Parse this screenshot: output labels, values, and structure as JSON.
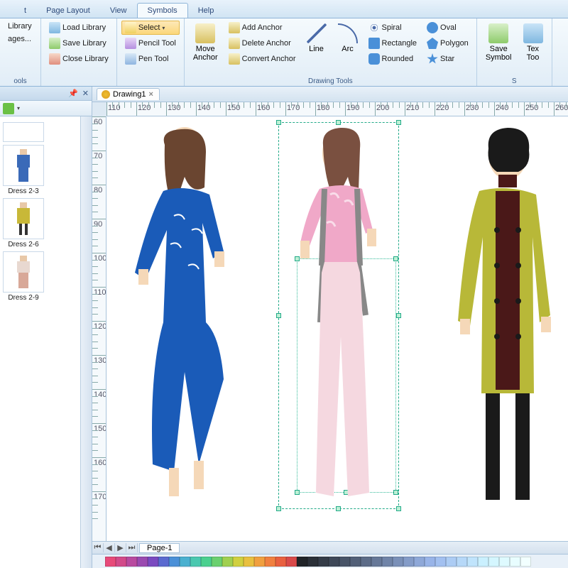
{
  "tabs": {
    "t0": "t",
    "t1": "Page Layout",
    "t2": "View",
    "t3": "Symbols",
    "t4": "Help"
  },
  "ribbon": {
    "library": {
      "load": "Load Library",
      "save": "Save Library",
      "close": "Close Library",
      "sideA": "Library",
      "sideB": "ages...",
      "group": "ools"
    },
    "select": {
      "select": "Select",
      "pencil": "Pencil Tool",
      "pen": "Pen Tool"
    },
    "move": "Move\nAnchor",
    "anchor": {
      "add": "Add Anchor",
      "del": "Delete Anchor",
      "conv": "Convert Anchor"
    },
    "line": "Line",
    "arc": "Arc",
    "shapes": {
      "spiral": "Spiral",
      "rect": "Rectangle",
      "round": "Rounded",
      "oval": "Oval",
      "poly": "Polygon",
      "star": "Star"
    },
    "group": "Drawing Tools",
    "saveSym": "Save\nSymbol",
    "text": "Tex\nToo",
    "groupS": "S"
  },
  "sidebar": {
    "items": [
      "Dress 2-3",
      "Dress 2-6",
      "Dress 2-9"
    ]
  },
  "doc": {
    "name": "Drawing1"
  },
  "page": {
    "name": "Page-1"
  },
  "rulerH": [
    110,
    120,
    130,
    140,
    150,
    160,
    170,
    180,
    190,
    200,
    210,
    220,
    230,
    240,
    250,
    260
  ],
  "rulerV": [
    60,
    70,
    80,
    90,
    100,
    110,
    120,
    130,
    140,
    150,
    160,
    170
  ],
  "colors": [
    "#e74a7a",
    "#d24a8a",
    "#b84aa0",
    "#9a4ab0",
    "#7a4ac0",
    "#5a6ad0",
    "#4a90d8",
    "#4ab0d0",
    "#4ac8b0",
    "#4ad090",
    "#6ad070",
    "#a0d050",
    "#d0d040",
    "#e8c040",
    "#f0a040",
    "#f08040",
    "#e86040",
    "#d84a4a",
    "#202428",
    "#2a3038",
    "#343c48",
    "#3e4858",
    "#485468",
    "#526078",
    "#5c6c88",
    "#667898",
    "#7084a8",
    "#7a90b8",
    "#849cc8",
    "#8ea8d8",
    "#98b4e8",
    "#a2c0f0",
    "#acccf4",
    "#b6d8f8",
    "#c0e4fc",
    "#caf0ff",
    "#d4f6ff",
    "#defaff",
    "#e8fdff",
    "#f2ffff"
  ]
}
